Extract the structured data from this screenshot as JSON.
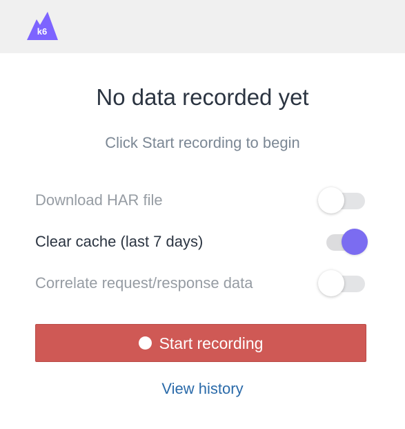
{
  "header": {
    "logo_text": "k6",
    "logo_color": "#7d64ff"
  },
  "main": {
    "title": "No data recorded yet",
    "subtitle": "Click Start recording to begin"
  },
  "options": [
    {
      "label": "Download HAR file",
      "enabled": false
    },
    {
      "label": "Clear cache (last 7 days)",
      "enabled": true
    },
    {
      "label": "Correlate request/response data",
      "enabled": false
    }
  ],
  "actions": {
    "start_label": "Start recording",
    "history_label": "View history"
  },
  "colors": {
    "accent": "#7b6cf1",
    "record_button": "#cf5955",
    "link": "#2a6aa9"
  }
}
